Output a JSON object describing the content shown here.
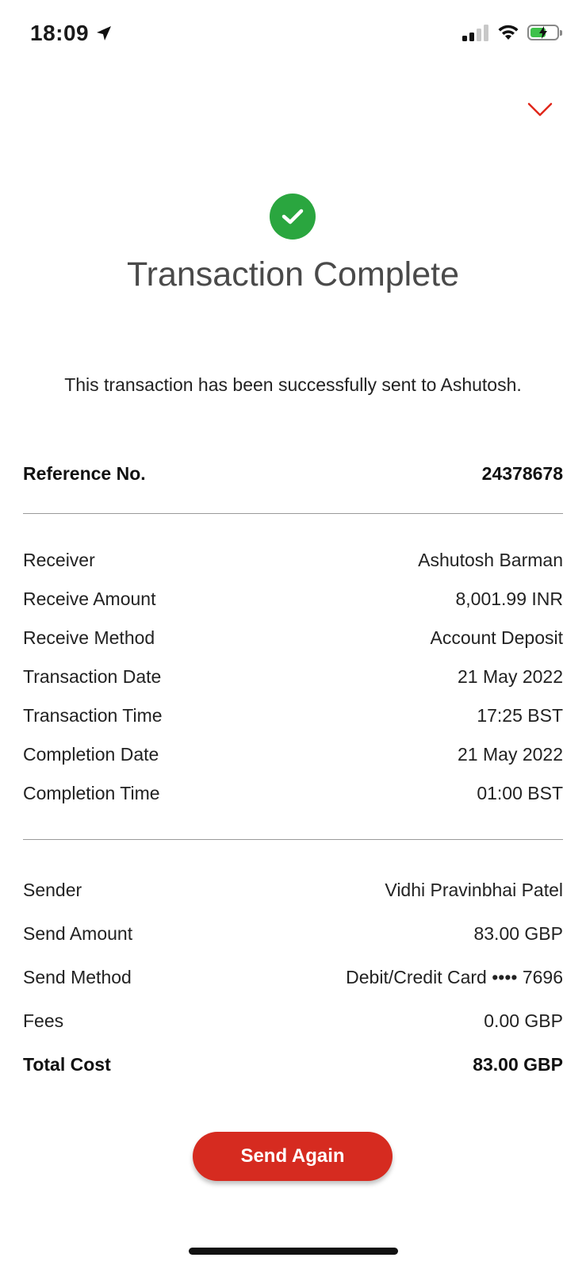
{
  "status_bar": {
    "time": "18:09",
    "icons": [
      "location-arrow-icon",
      "signal-icon",
      "wifi-icon",
      "battery-charging-icon"
    ],
    "battery_level": 0.6
  },
  "header": {
    "collapse_icon": "chevron-down-icon"
  },
  "colors": {
    "primary": "#d62b20",
    "success": "#2aa63f"
  },
  "main": {
    "title": "Transaction Complete",
    "message": "This transaction has been successfully sent to Ashutosh.",
    "reference": {
      "label": "Reference No.",
      "value": "24378678"
    },
    "receiver_details": [
      {
        "label": "Receiver",
        "value": "Ashutosh Barman"
      },
      {
        "label": "Receive Amount",
        "value": "8,001.99 INR"
      },
      {
        "label": "Receive Method",
        "value": "Account Deposit"
      },
      {
        "label": "Transaction Date",
        "value": "21 May 2022"
      },
      {
        "label": "Transaction Time",
        "value": "17:25 BST"
      },
      {
        "label": "Completion Date",
        "value": "21 May 2022"
      },
      {
        "label": "Completion Time",
        "value": "01:00 BST"
      }
    ],
    "sender_details": [
      {
        "label": "Sender",
        "value": "Vidhi Pravinbhai Patel"
      },
      {
        "label": "Send Amount",
        "value": "83.00 GBP"
      },
      {
        "label": "Send Method",
        "value": "Debit/Credit Card •••• 7696"
      },
      {
        "label": "Fees",
        "value": "0.00 GBP"
      }
    ],
    "total": {
      "label": "Total Cost",
      "value": "83.00 GBP"
    },
    "send_again_label": "Send Again"
  }
}
